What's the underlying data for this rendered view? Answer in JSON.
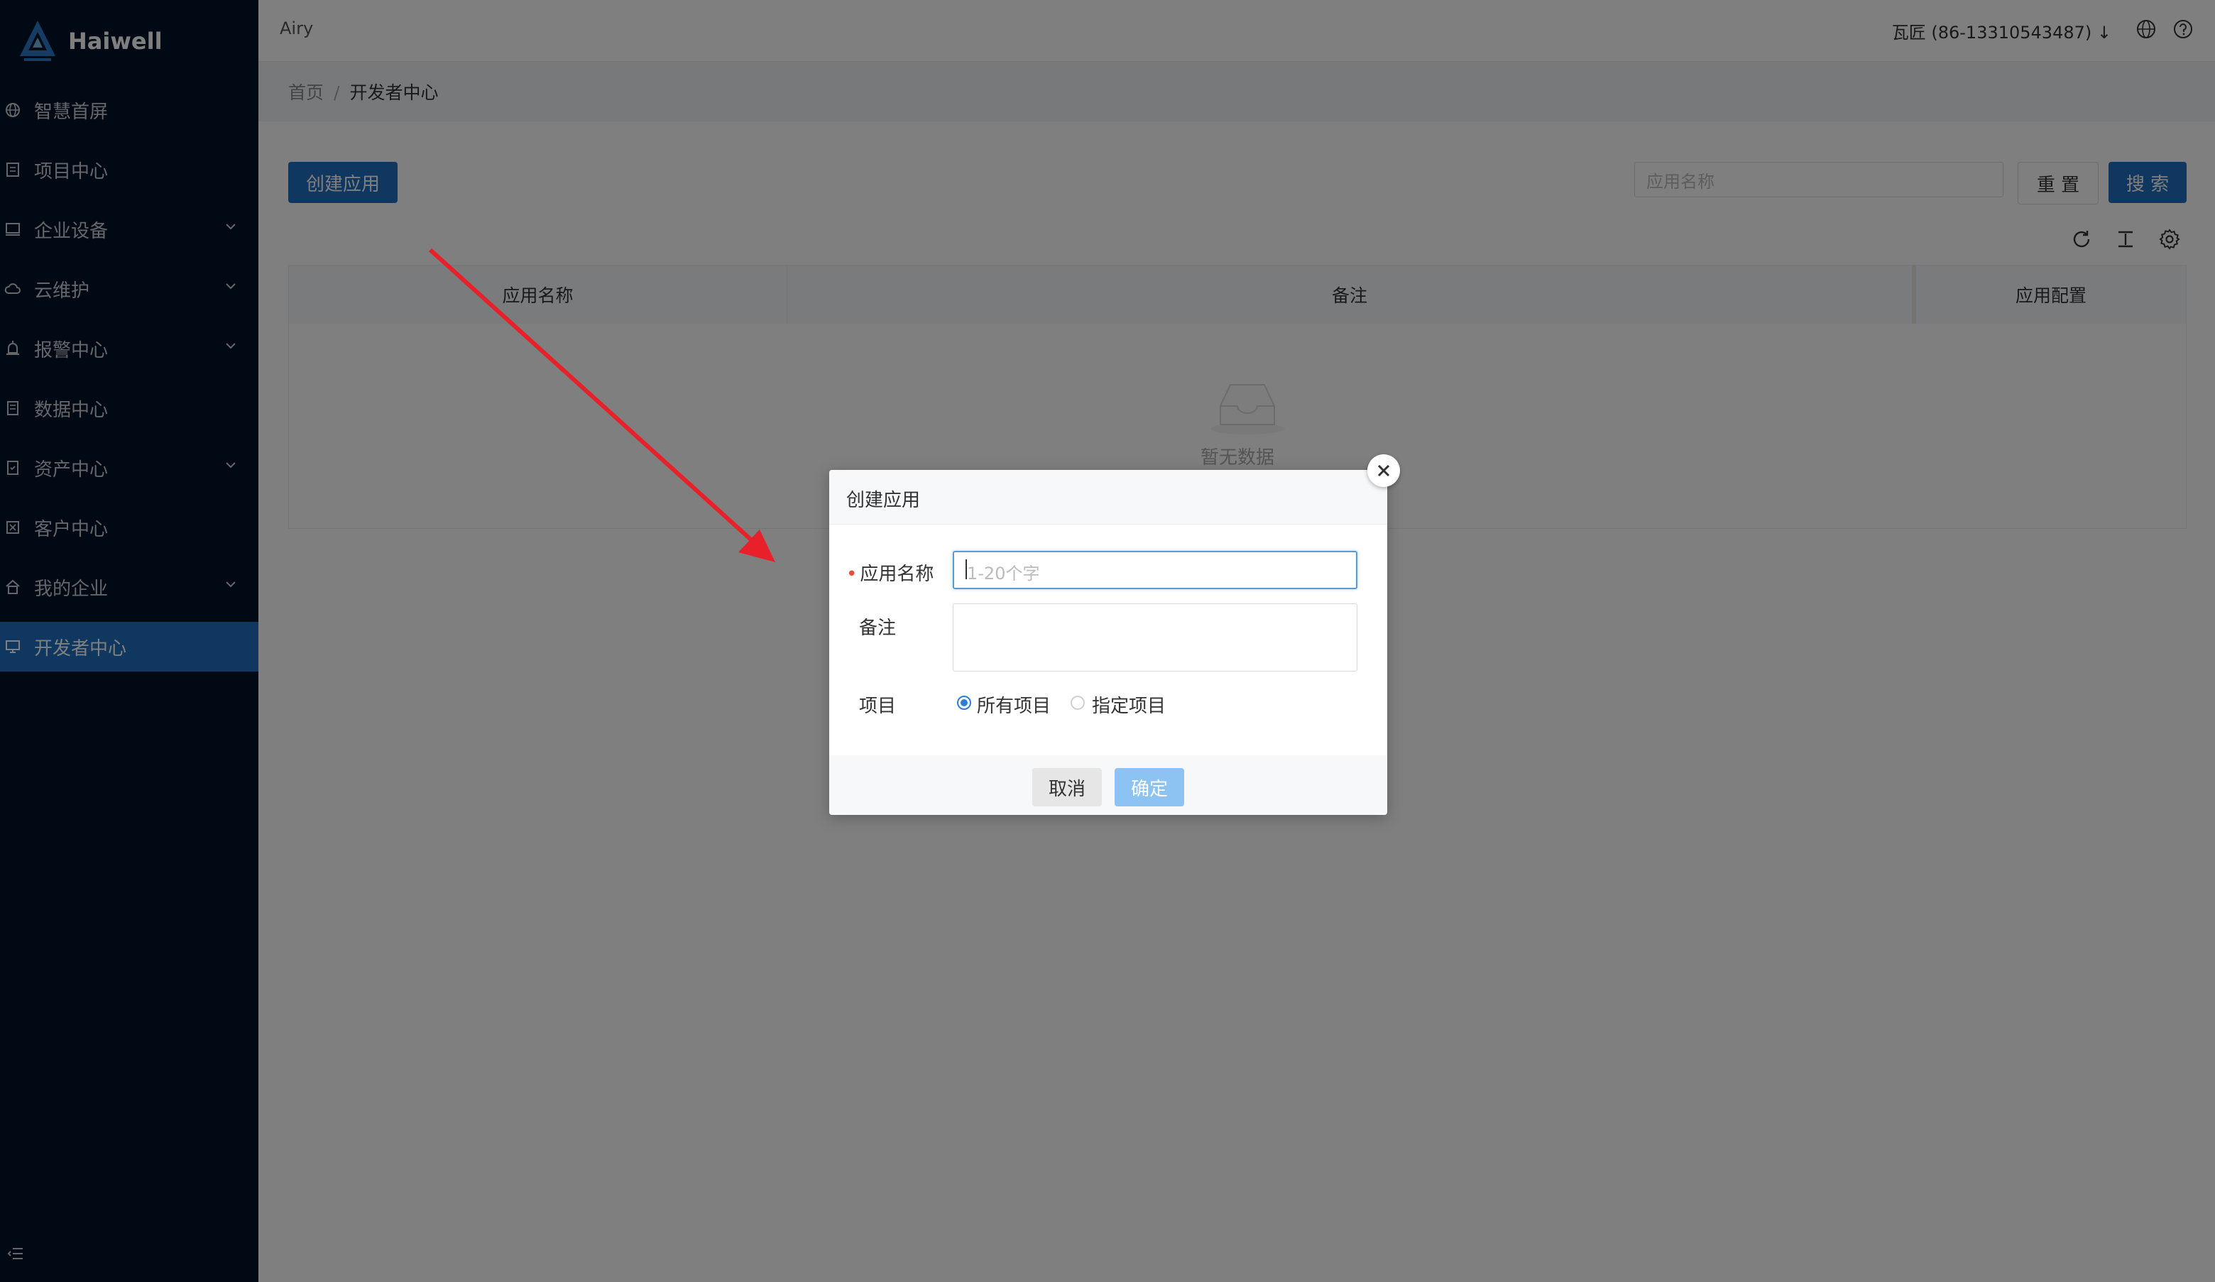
{
  "brand": {
    "name": "Haiwell"
  },
  "sidebar": {
    "items": [
      {
        "label": "智慧首屏",
        "icon": "globe-icon",
        "has_children": false
      },
      {
        "label": "项目中心",
        "icon": "document-icon",
        "has_children": false
      },
      {
        "label": "企业设备",
        "icon": "monitor-icon",
        "has_children": true
      },
      {
        "label": "云维护",
        "icon": "cloud-icon",
        "has_children": true
      },
      {
        "label": "报警中心",
        "icon": "alarm-icon",
        "has_children": true
      },
      {
        "label": "数据中心",
        "icon": "database-icon",
        "has_children": false
      },
      {
        "label": "资产中心",
        "icon": "asset-icon",
        "has_children": true
      },
      {
        "label": "客户中心",
        "icon": "customer-icon",
        "has_children": false
      },
      {
        "label": "我的企业",
        "icon": "home-icon",
        "has_children": true
      },
      {
        "label": "开发者中心",
        "icon": "desktop-icon",
        "has_children": false,
        "active": true
      }
    ]
  },
  "header": {
    "tenant": "Airy",
    "user": "瓦匠 (86-13310543487) ↓"
  },
  "breadcrumb": {
    "home": "首页",
    "separator": "/",
    "current": "开发者中心"
  },
  "toolbar": {
    "create_label": "创建应用",
    "search_placeholder": "应用名称",
    "reset_label": "重 置",
    "search_label": "搜 索"
  },
  "table": {
    "columns": [
      "应用名称",
      "备注",
      "应用配置"
    ],
    "empty_text": "暂无数据"
  },
  "modal": {
    "title": "创建应用",
    "fields": {
      "name_label": "应用名称",
      "name_placeholder": "1-20个字",
      "remark_label": "备注",
      "project_label": "项目"
    },
    "radio_options": [
      "所有项目",
      "指定项目"
    ],
    "selected_option": "所有项目",
    "cancel_label": "取消",
    "ok_label": "确定"
  },
  "colors": {
    "sidebar_bg": "#021428",
    "primary": "#1e6fbf",
    "annotation_arrow": "#e8202a",
    "required_mark": "#e74c3c"
  }
}
